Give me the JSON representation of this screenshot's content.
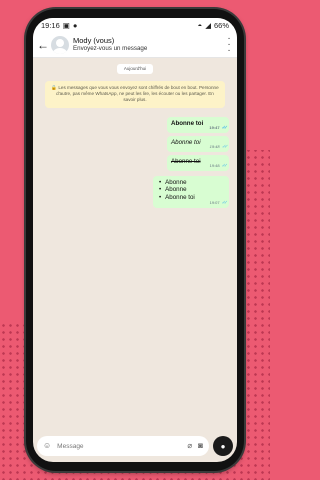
{
  "status_bar": {
    "time": "19:16",
    "battery": "66%"
  },
  "header": {
    "contact_name": "Mody (vous)",
    "subtitle": "Envoyez-vous un message"
  },
  "chat": {
    "date_label": "Aujourd'hui",
    "encryption_notice": "🔒 Les messages que vous vous envoyez sont chiffrés de bout en bout. Personne d'autre, pas même WhatsApp, ne peut les lire, les écouter ou les partager. En savoir plus.",
    "messages": [
      {
        "text": "Abonne toi",
        "time": "19:47",
        "style": "bold"
      },
      {
        "text": "Abonne toi",
        "time": "19:48",
        "style": "italic"
      },
      {
        "text": "Abonne toi",
        "time": "19:48",
        "style": "strikethrough"
      },
      {
        "items": [
          "Abonne",
          "Abonne",
          "Abonne toi"
        ],
        "time": "19:07",
        "style": "list"
      }
    ]
  },
  "composer": {
    "placeholder": "Message"
  },
  "icons": {
    "back": "arrow-left-icon",
    "menu": "kebab-menu-icon",
    "emoji": "sticker-icon",
    "attach": "paperclip-icon",
    "camera": "camera-icon",
    "mic": "microphone-icon"
  },
  "colors": {
    "background": "#ec5a72",
    "bubble_out": "#d8fdd2",
    "read_ticks": "#53bdeb",
    "chat_bg": "#efe7de"
  }
}
